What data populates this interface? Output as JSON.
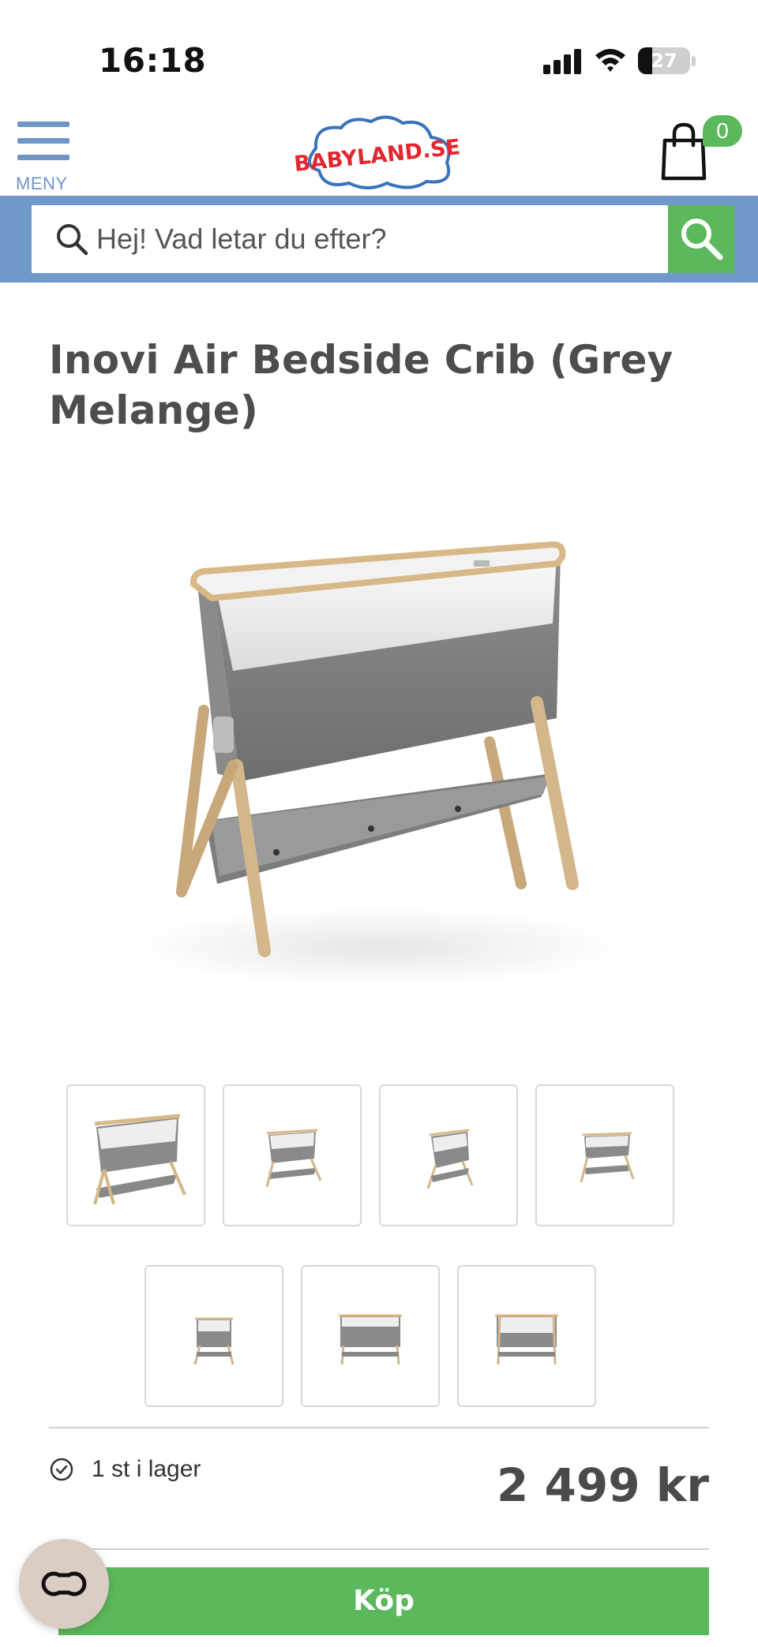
{
  "status_bar": {
    "time": "16:18",
    "battery": "27",
    "battery_level": 0.27,
    "icons": [
      "signal-icon",
      "wifi-icon",
      "battery-icon"
    ]
  },
  "header": {
    "menu_label": "MENY",
    "logo_text": "BABYLAND.SE",
    "cart_count": "0"
  },
  "search": {
    "placeholder": "Hej! Vad letar du efter?",
    "value": ""
  },
  "product": {
    "title": "Inovi Air Bedside Crib (Grey Melange)",
    "stock_text": "1 st i lager",
    "price": "2 499 kr",
    "buy_label": "Köp",
    "thumbnail_count": 7
  },
  "colors": {
    "accent_blue": "#7099c9",
    "accent_green": "#5cb85c",
    "logo_red": "#e2272e",
    "logo_blue": "#3b73b9",
    "text_dark": "#4a4a4a"
  }
}
